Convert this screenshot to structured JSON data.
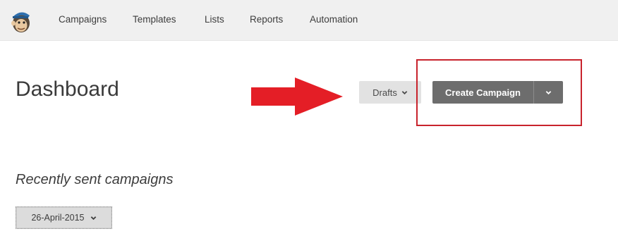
{
  "nav": {
    "items": [
      {
        "label": "Campaigns"
      },
      {
        "label": "Templates"
      },
      {
        "label": "Lists"
      },
      {
        "label": "Reports"
      },
      {
        "label": "Automation"
      }
    ]
  },
  "page": {
    "title": "Dashboard"
  },
  "actions": {
    "drafts_label": "Drafts",
    "create_label": "Create Campaign"
  },
  "recent": {
    "heading": "Recently sent campaigns",
    "selected_date": "26-April-2015"
  },
  "colors": {
    "topbar_bg": "#f0f0f0",
    "primary_button": "#6d6d6d",
    "annotation_red": "#e41e26",
    "annotation_box": "#c8232c"
  },
  "icons": {
    "logo": "monkey-logo-icon",
    "dropdown": "chevron-down-icon",
    "annotation": "red-arrow-icon"
  }
}
